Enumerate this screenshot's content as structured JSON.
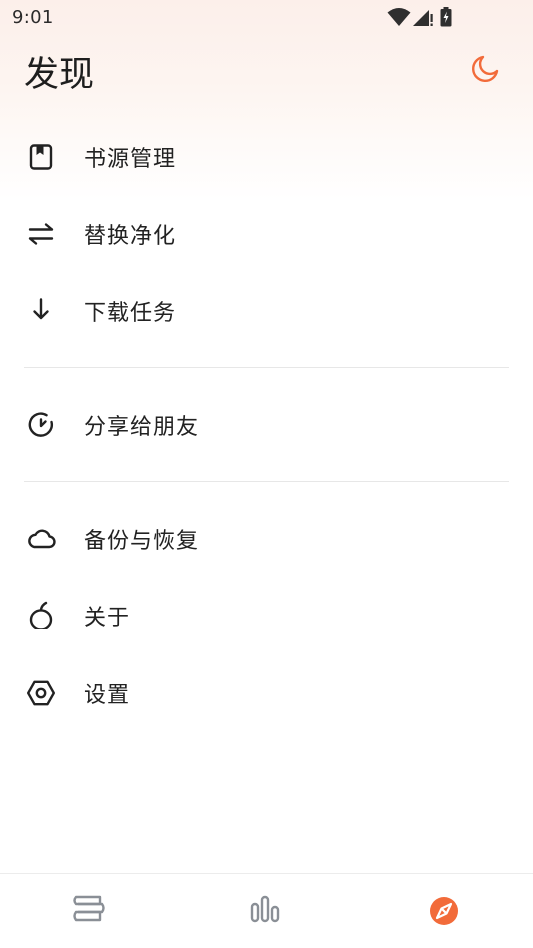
{
  "status_bar": {
    "time": "9:01",
    "icons": [
      "wifi-icon",
      "cellular-signal-icon",
      "battery-icon"
    ]
  },
  "header": {
    "title": "发现",
    "theme_icon": "moon-icon"
  },
  "menu": {
    "items": [
      {
        "label": "书源管理",
        "icon": "book-source-icon"
      },
      {
        "label": "替换净化",
        "icon": "swap-arrows-icon"
      },
      {
        "label": "下载任务",
        "icon": "download-arrow-icon"
      },
      {
        "label": "分享给朋友",
        "icon": "share-refresh-icon"
      },
      {
        "label": "备份与恢复",
        "icon": "cloud-icon"
      },
      {
        "label": "关于",
        "icon": "info-apple-icon"
      },
      {
        "label": "设置",
        "icon": "hexagon-settings-icon"
      }
    ]
  },
  "bottom_nav": {
    "items": [
      {
        "icon": "bookshelf-icon",
        "active": false
      },
      {
        "icon": "ranking-bars-icon",
        "active": false
      },
      {
        "icon": "compass-icon",
        "active": true
      }
    ]
  },
  "colors": {
    "accent": "#f26b3a",
    "icon": "#222222",
    "inactive_nav": "#8a8f96"
  }
}
